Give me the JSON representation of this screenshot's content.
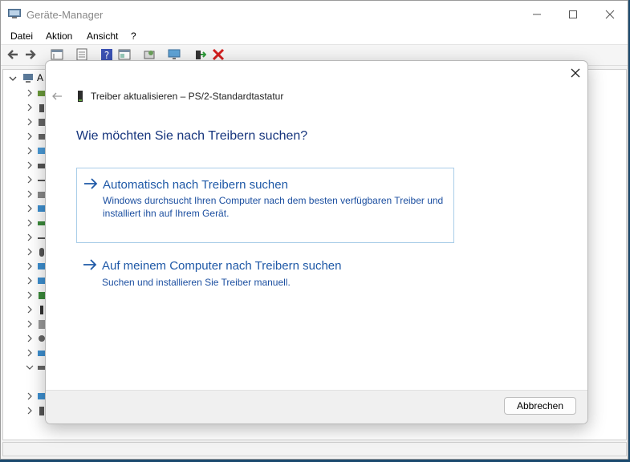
{
  "window": {
    "title": "Geräte-Manager",
    "controls": [
      "minimize",
      "maximize",
      "close"
    ]
  },
  "menu": {
    "items": [
      "Datei",
      "Aktion",
      "Ansicht",
      "?"
    ]
  },
  "tree": {
    "root_label": "A"
  },
  "dialog": {
    "title": "Treiber aktualisieren – PS/2-Standardtastatur",
    "heading": "Wie möchten Sie nach Treibern suchen?",
    "options": [
      {
        "title": "Automatisch nach Treibern suchen",
        "desc_line1": "Windows durchsucht Ihren Computer nach dem besten verfügbaren Treiber und",
        "desc_line2": "installiert ihn auf Ihrem Gerät."
      },
      {
        "title": "Auf meinem Computer nach Treibern suchen",
        "desc_line1": "Suchen und installieren Sie Treiber manuell."
      }
    ],
    "cancel_label": "Abbrechen"
  },
  "colors": {
    "accent": "#1f59a7",
    "heading": "#16357d",
    "focus_border": "#a9cde8"
  }
}
